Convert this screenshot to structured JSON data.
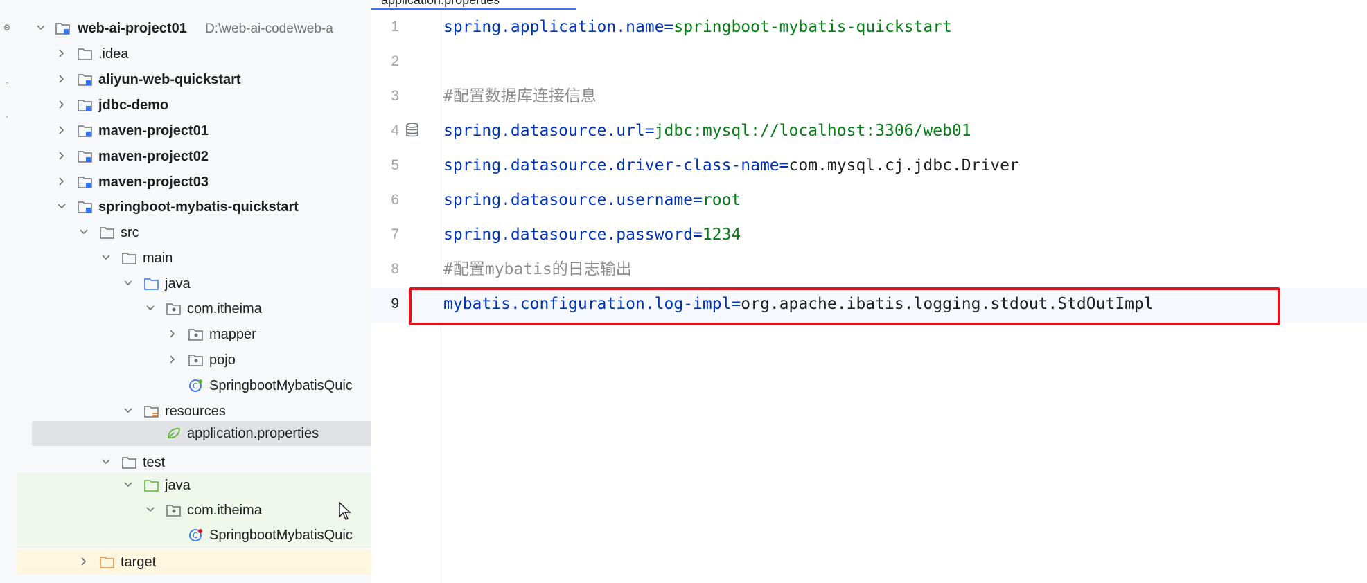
{
  "editor_tab": {
    "label": "application.properties"
  },
  "project_tree": {
    "root": {
      "label": "web-ai-project01",
      "path": "D:\\web-ai-code\\web-a"
    },
    "items": [
      {
        "label": ".idea"
      },
      {
        "label": "aliyun-web-quickstart"
      },
      {
        "label": "jdbc-demo"
      },
      {
        "label": "maven-project01"
      },
      {
        "label": "maven-project02"
      },
      {
        "label": "maven-project03"
      },
      {
        "label": "springboot-mybatis-quickstart"
      },
      {
        "label": "src"
      },
      {
        "label": "main"
      },
      {
        "label": "java"
      },
      {
        "label": "com.itheima"
      },
      {
        "label": "mapper"
      },
      {
        "label": "pojo"
      },
      {
        "label": "SpringbootMybatisQuic"
      },
      {
        "label": "resources"
      },
      {
        "label": "application.properties"
      },
      {
        "label": "test"
      },
      {
        "label": "java"
      },
      {
        "label": "com.itheima"
      },
      {
        "label": "SpringbootMybatisQuic"
      },
      {
        "label": "target"
      }
    ]
  },
  "editor": {
    "current_line": 9,
    "lines": [
      {
        "num": "1",
        "key": "spring.application.name",
        "eq": "=",
        "value": "springboot-mybatis-quickstart"
      },
      {
        "num": "2"
      },
      {
        "num": "3",
        "comment": "#配置数据库连接信息"
      },
      {
        "num": "4",
        "key": "spring.datasource.url",
        "eq": "=",
        "value": "jdbc:mysql://localhost:3306/web01"
      },
      {
        "num": "5",
        "key": "spring.datasource.driver-class-name",
        "eq": "=",
        "value": "com.mysql.cj.jdbc.Driver"
      },
      {
        "num": "6",
        "key": "spring.datasource.username",
        "eq": "=",
        "value": "root"
      },
      {
        "num": "7",
        "key": "spring.datasource.password",
        "eq": "=",
        "value": "1234"
      },
      {
        "num": "8",
        "comment": "#配置mybatis的日志输出"
      },
      {
        "num": "9",
        "key": "mybatis.configuration.log-impl",
        "eq": "=",
        "value": "org.apache.ibatis.logging.stdout.StdOutImpl"
      }
    ]
  },
  "colors": {
    "key": "#0033b3",
    "value": "#067d17",
    "comment": "#8c8c8c",
    "highlight_box": "#e0141e",
    "selection": "#dfe1e5",
    "test_background": "#eef7ea"
  }
}
